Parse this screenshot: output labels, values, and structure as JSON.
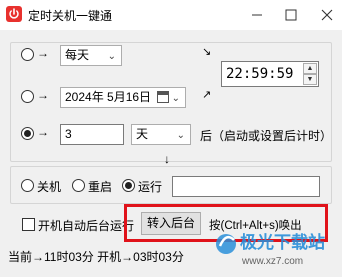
{
  "window": {
    "title": "定时关机一键通",
    "controls": [
      "minimize",
      "maximize",
      "close"
    ]
  },
  "schedule": {
    "daily": {
      "arrow": "→",
      "frequency": "每天"
    },
    "date": {
      "arrow": "→",
      "value": "2024年 5月16日"
    },
    "countdown": {
      "arrow": "→",
      "amount": "3",
      "unit": "天",
      "suffix": "后（启动或设置后计时）",
      "selected": true
    },
    "time": "22:59:59",
    "arrow_down": "↓",
    "arrow_nw": "↘",
    "arrow_ne": "↗"
  },
  "actions": {
    "shutdown": "关机",
    "restart": "重启",
    "run": "运行",
    "selected": "运行",
    "run_command": ""
  },
  "options": {
    "autostart_label": "开机自动后台运行",
    "background_button": "转入后台",
    "hotkey_hint": "按(Ctrl+Alt+s)唤出"
  },
  "status": {
    "text": "当前→11时03分 开机→03时03分"
  },
  "watermark": {
    "text": "极光下载站",
    "url": "www.xz7.com"
  },
  "colors": {
    "accent_red": "#e0121a",
    "app_icon": "#e8312e"
  }
}
